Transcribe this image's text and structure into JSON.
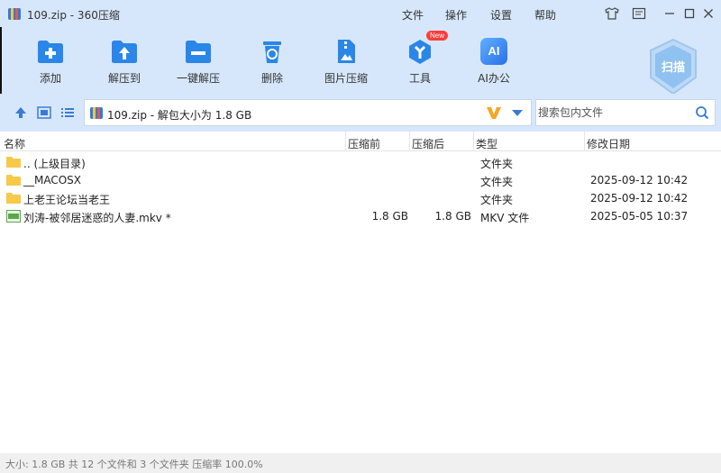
{
  "window": {
    "title": "109.zip - 360压缩",
    "menu": [
      "文件",
      "操作",
      "设置",
      "帮助"
    ]
  },
  "toolbar": {
    "items": [
      {
        "label": "添加",
        "icon": "add-icon"
      },
      {
        "label": "解压到",
        "icon": "extract-to-icon"
      },
      {
        "label": "一键解压",
        "icon": "one-click-extract-icon"
      },
      {
        "label": "删除",
        "icon": "delete-icon"
      },
      {
        "label": "图片压缩",
        "icon": "image-compress-icon"
      },
      {
        "label": "工具",
        "icon": "tools-icon",
        "badge": "New"
      },
      {
        "label": "AI办公",
        "icon": "ai-office-icon",
        "icon_text": "AI"
      }
    ],
    "scan_label": "扫描"
  },
  "address": {
    "path": "109.zip - 解包大小为 1.8 GB",
    "search_placeholder": "搜索包内文件"
  },
  "columns": [
    "名称",
    "压缩前",
    "压缩后",
    "类型",
    "修改日期"
  ],
  "files": [
    {
      "name": ".. (上级目录)",
      "size_before": "",
      "size_after": "",
      "type": "文件夹",
      "date": "",
      "icon": "folder-icon"
    },
    {
      "name": "__MACOSX",
      "size_before": "",
      "size_after": "",
      "type": "文件夹",
      "date": "2025-09-12 10:42",
      "icon": "folder-icon"
    },
    {
      "name": "上老王论坛当老王",
      "size_before": "",
      "size_after": "",
      "type": "文件夹",
      "date": "2025-09-12 10:42",
      "icon": "folder-icon"
    },
    {
      "name": "刘涛-被邻居迷惑的人妻.mkv *",
      "size_before": "1.8 GB",
      "size_after": "1.8 GB",
      "type": "MKV 文件",
      "date": "2025-05-05 10:37",
      "icon": "video-file-icon"
    }
  ],
  "status": {
    "text": "大小: 1.8 GB 共 12 个文件和 3 个文件夹 压缩率 100.0%"
  },
  "colors": {
    "chrome_bg": "#d7e7fb",
    "accent_blue": "#1e88e5",
    "folder_yellow": "#f7c948"
  }
}
